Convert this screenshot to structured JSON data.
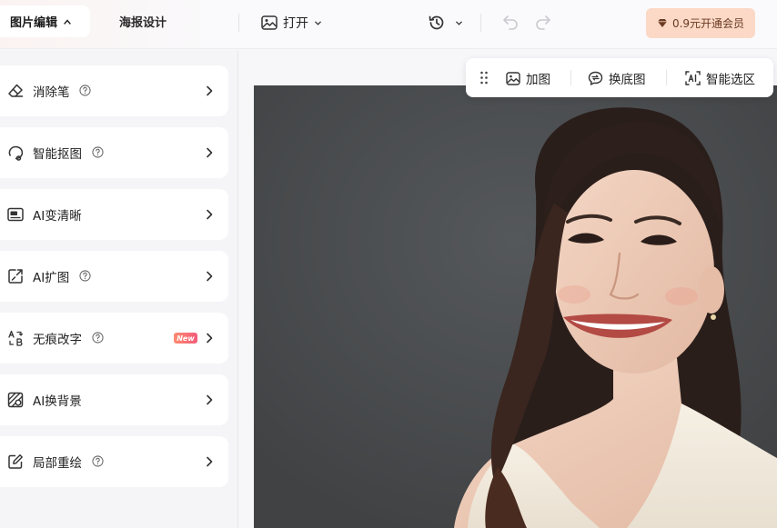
{
  "topbar": {
    "tabs": [
      {
        "label": "图片编辑",
        "active": true
      },
      {
        "label": "海报设计",
        "active": false
      }
    ],
    "open_label": "打开",
    "vip_label": "0.9元开通会员"
  },
  "sidebar": {
    "items": [
      {
        "label": "消除笔",
        "icon": "eraser-icon",
        "help": true,
        "badge": ""
      },
      {
        "label": "智能抠图",
        "icon": "lasso-icon",
        "help": true,
        "badge": ""
      },
      {
        "label": "AI变清晰",
        "icon": "hd-icon",
        "help": false,
        "badge": ""
      },
      {
        "label": "AI扩图",
        "icon": "expand-icon",
        "help": true,
        "badge": ""
      },
      {
        "label": "无痕改字",
        "icon": "text-replace-icon",
        "help": true,
        "badge": "New"
      },
      {
        "label": "AI换背景",
        "icon": "background-icon",
        "help": false,
        "badge": ""
      },
      {
        "label": "局部重绘",
        "icon": "edit-icon",
        "help": true,
        "badge": ""
      }
    ]
  },
  "float_toolbar": {
    "add_image_label": "加图",
    "change_bg_label": "换底图",
    "smart_select_label": "智能选区"
  },
  "colors": {
    "vip_bg": "#fbd9c6",
    "vip_text": "#6b3a22",
    "new_badge": "#f25c7a"
  }
}
